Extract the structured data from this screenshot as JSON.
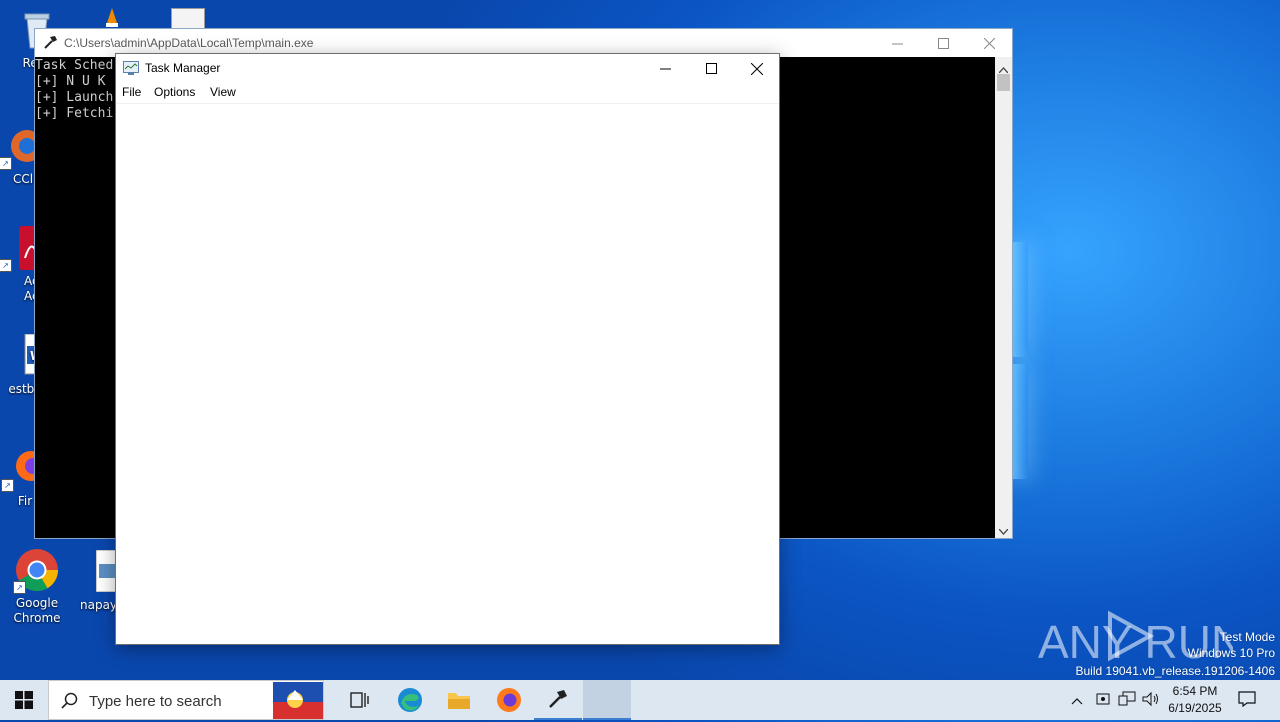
{
  "desktop": {
    "icons": [
      {
        "label": "Recy",
        "icon": "recycle-bin-icon"
      },
      {
        "label": "CCl",
        "icon": "ccleaner-icon"
      },
      {
        "label": "Ad Acr",
        "icon": "adobe-acrobat-icon"
      },
      {
        "label": "estbl",
        "icon": "word-document-icon"
      },
      {
        "label": "Fir",
        "icon": "firefox-icon"
      },
      {
        "label": "Google Chrome",
        "icon": "chrome-icon"
      },
      {
        "label": "napayr",
        "icon": "image-file-icon"
      }
    ]
  },
  "console_window": {
    "title": "C:\\Users\\admin\\AppData\\Local\\Temp\\main.exe",
    "lines": [
      "Task Sched",
      "[+] N U K",
      "[+] Launch",
      "[+] Fetchi"
    ],
    "buttons": {
      "minimize": "—",
      "maximize": "☐",
      "close": "✕"
    }
  },
  "task_manager": {
    "title": "Task Manager",
    "menu": [
      "File",
      "Options",
      "View"
    ],
    "buttons": {
      "minimize": "—",
      "maximize": "☐",
      "close": "✕"
    }
  },
  "taskbar": {
    "search_placeholder": "Type here to search",
    "apps": [
      "task-view-icon",
      "edge-icon",
      "file-explorer-icon",
      "firefox-icon",
      "main-exe-icon",
      "active-window-button"
    ],
    "clock": {
      "time": "6:54 PM",
      "date": "6/19/2025"
    }
  },
  "watermark": {
    "brand": "ANY RUN",
    "lines": [
      "Test Mode",
      "Windows 10 Pro",
      "Build 19041.vb_release.191206-1406"
    ]
  },
  "colors": {
    "desktop_blue": "#0b55c4",
    "taskbar": "#dce7f2",
    "console_bg": "#000000"
  }
}
